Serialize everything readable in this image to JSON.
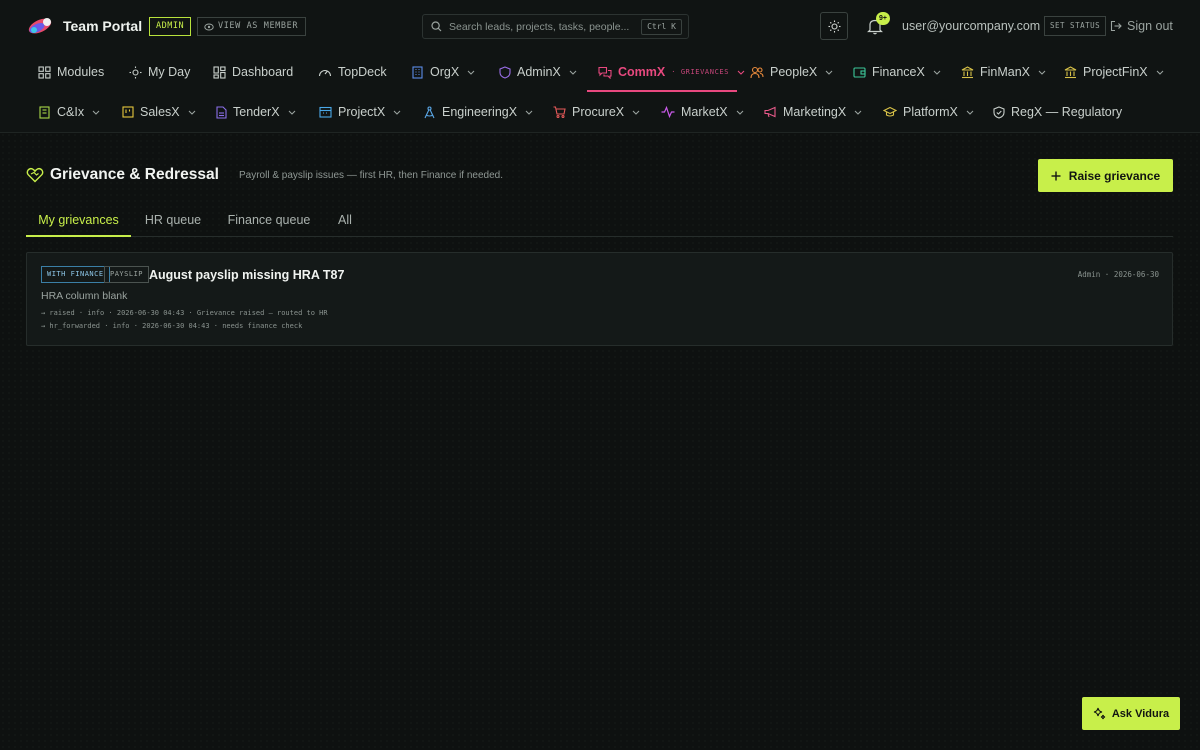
{
  "app": {
    "brand": "Team Portal",
    "role_badge": "ADMIN",
    "view_as": "VIEW AS MEMBER"
  },
  "search": {
    "placeholder": "Search leads, projects, tasks, people...",
    "shortcut": "Ctrl K"
  },
  "notifications": {
    "count": "9+"
  },
  "user": {
    "email": "user@yourcompany.com",
    "set_status": "SET STATUS",
    "sign_out": "Sign out"
  },
  "nav_row1": [
    {
      "label": "Modules",
      "icon": "grid-icon",
      "color": "#c9d0cc"
    },
    {
      "label": "My Day",
      "icon": "sun-icon",
      "color": "#c9d0cc"
    },
    {
      "label": "Dashboard",
      "icon": "dashboard-icon",
      "color": "#c9d0cc"
    },
    {
      "label": "TopDeck",
      "icon": "gauge-icon",
      "color": "#c9d0cc"
    },
    {
      "label": "OrgX",
      "icon": "building-icon",
      "color": "#5b8de8"
    },
    {
      "label": "AdminX",
      "icon": "shield-icon",
      "color": "#9a6ee8"
    },
    {
      "label": "CommX",
      "sub": "· GRIEVANCES",
      "icon": "chat-icon",
      "color": "#e8497f"
    },
    {
      "label": "PeopleX",
      "icon": "people-icon",
      "color": "#e88a3c"
    },
    {
      "label": "FinanceX",
      "icon": "wallet-icon",
      "color": "#3cc89a"
    },
    {
      "label": "FinManX",
      "icon": "bank-icon",
      "color": "#d8c248"
    },
    {
      "label": "ProjectFinX",
      "icon": "bank-icon",
      "color": "#d8c248"
    }
  ],
  "nav_row2": [
    {
      "label": "C&Ix",
      "icon": "building-icon",
      "color": "#a8d848"
    },
    {
      "label": "SalesX",
      "icon": "kanban-icon",
      "color": "#e8c83c"
    },
    {
      "label": "TenderX",
      "icon": "document-icon",
      "color": "#8a6ee8"
    },
    {
      "label": "ProjectX",
      "icon": "calendar-icon",
      "color": "#4aa8e8"
    },
    {
      "label": "EngineeringX",
      "icon": "compass-icon",
      "color": "#5ba8e8"
    },
    {
      "label": "ProcureX",
      "icon": "cart-icon",
      "color": "#e85a5a"
    },
    {
      "label": "MarketX",
      "icon": "pulse-icon",
      "color": "#c85ae8"
    },
    {
      "label": "MarketingX",
      "icon": "megaphone-icon",
      "color": "#e85a8a"
    },
    {
      "label": "PlatformX",
      "icon": "graduation-icon",
      "color": "#d8c248"
    },
    {
      "label": "RegX — Regulatory",
      "icon": "shield-check-icon",
      "color": "#c9d0cc"
    }
  ],
  "page": {
    "title": "Grievance & Redressal",
    "subtitle": "Payroll & payslip issues — first HR, then Finance if needed.",
    "raise_button": "Raise grievance"
  },
  "tabs": [
    {
      "label": "My grievances",
      "active": true
    },
    {
      "label": "HR queue",
      "active": false
    },
    {
      "label": "Finance queue",
      "active": false
    },
    {
      "label": "All",
      "active": false
    }
  ],
  "grievance": {
    "status_tag": "WITH FINANCE",
    "category_tag": "PAYSLIP",
    "title": "August payslip missing HRA T87",
    "meta": "Admin · 2026-06-30",
    "description": "HRA column blank",
    "trail": [
      "→ raised · info · 2026-06-30 04:43 · Grievance raised — routed to HR",
      "→ hr_forwarded · info · 2026-06-30 04:43 · needs finance check"
    ]
  },
  "assistant": {
    "label": "Ask Vidura"
  },
  "colors": {
    "accent": "#c8ef4a",
    "active_module": "#e8497f",
    "background": "#0e1110"
  }
}
